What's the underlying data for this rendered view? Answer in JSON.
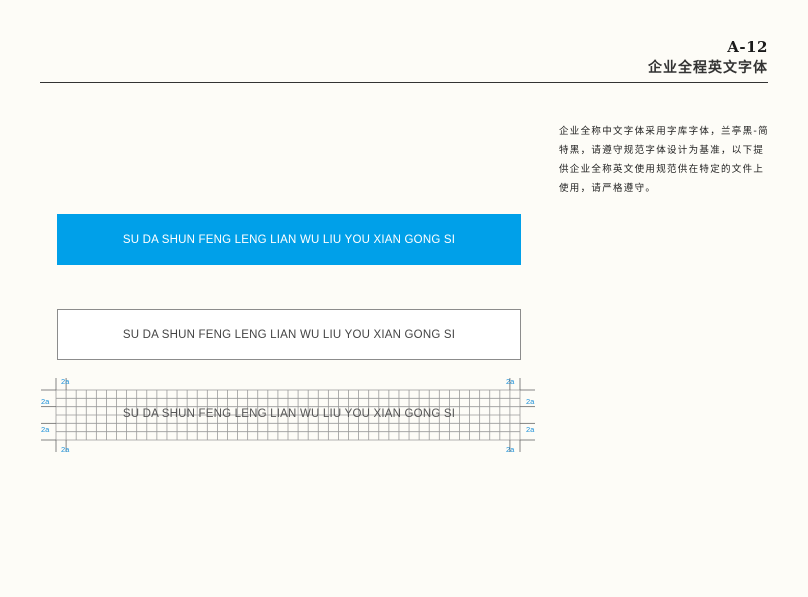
{
  "header": {
    "code": "A-12",
    "title": "企业全程英文字体"
  },
  "description": "企业全称中文字体采用字库字体，兰亭黑-简特黑，请遵守规范字体设计为基准，以下提供企业全称英文使用规范供在特定的文件上使用，请严格遵守。",
  "samples": {
    "blue_text": "SU DA SHUN FENG LENG LIAN WU LIU YOU XIAN GONG SI",
    "outline_text": "SU DA SHUN FENG LENG LIAN WU LIU YOU XIAN GONG SI",
    "grid_text": "SU DA SHUN FENG LENG LIAN WU LIU YOU XIAN GONG SI"
  },
  "grid": {
    "margin_label": "2a",
    "columns": 46,
    "rows": 6
  },
  "colors": {
    "brand_blue": "#00a0e9",
    "background": "#fdfcf7",
    "label_blue": "#1a8fd8"
  }
}
